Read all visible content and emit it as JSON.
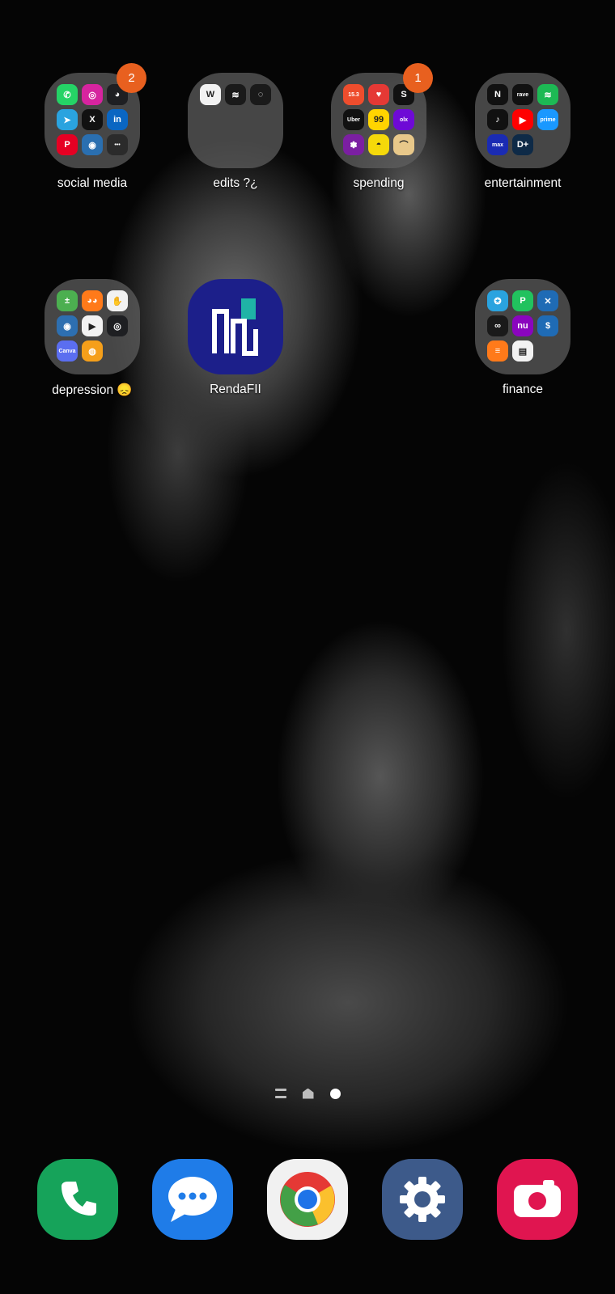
{
  "home": {
    "folders": [
      {
        "name": "social media",
        "badge": "2",
        "icons": [
          {
            "name": "whatsapp-icon",
            "color": "#25d366",
            "glyph": "✆"
          },
          {
            "name": "instagram-icon",
            "color": "#d6249f",
            "glyph": "◎"
          },
          {
            "name": "discord-icon",
            "color": "#1e1f22",
            "glyph": "◕"
          },
          {
            "name": "telegram-icon",
            "color": "#2aa3df",
            "glyph": "➤"
          },
          {
            "name": "x-icon",
            "color": "#111111",
            "glyph": "X"
          },
          {
            "name": "linkedin-icon",
            "color": "#0a66c2",
            "glyph": "in"
          },
          {
            "name": "pinterest-icon",
            "color": "#e60023",
            "glyph": "P"
          },
          {
            "name": "bot-icon",
            "color": "#2a6fb0",
            "glyph": "◉"
          },
          {
            "name": "dots-app-icon",
            "color": "#2b2b2b",
            "glyph": "•••"
          }
        ]
      },
      {
        "name": "edits ?¿",
        "badge": "",
        "icons": [
          {
            "name": "word-icon",
            "color": "#f2f2f2",
            "glyph": "W"
          },
          {
            "name": "capcut-icon",
            "color": "#1a1a1a",
            "glyph": "≋"
          },
          {
            "name": "alight-icon",
            "color": "#1a1a1a",
            "glyph": "◌"
          }
        ]
      },
      {
        "name": "spending",
        "badge": "1",
        "icons": [
          {
            "name": "shopee-icon",
            "color": "#ee4d2d",
            "glyph": "15.3"
          },
          {
            "name": "shopping-bag-icon",
            "color": "#e53935",
            "glyph": "♥"
          },
          {
            "name": "shein-icon",
            "color": "#111111",
            "glyph": "S"
          },
          {
            "name": "uber-icon",
            "color": "#111111",
            "glyph": "Uber"
          },
          {
            "name": "99-icon",
            "color": "#ffd400",
            "glyph": "99"
          },
          {
            "name": "olx-icon",
            "color": "#6e0ad6",
            "glyph": "olx"
          },
          {
            "name": "ifood-icon",
            "color": "#7b1fa2",
            "glyph": "✽"
          },
          {
            "name": "burger-icon",
            "color": "#f5d90a",
            "glyph": "◓"
          },
          {
            "name": "amazon-icon",
            "color": "#e8c88a",
            "glyph": "⌒"
          }
        ]
      },
      {
        "name": "entertainment",
        "badge": "",
        "icons": [
          {
            "name": "netflix-icon",
            "color": "#111111",
            "glyph": "N"
          },
          {
            "name": "rave-icon",
            "color": "#111111",
            "glyph": "rave"
          },
          {
            "name": "spotify-icon",
            "color": "#1db954",
            "glyph": "≋"
          },
          {
            "name": "tiktok-icon",
            "color": "#111111",
            "glyph": "♪"
          },
          {
            "name": "youtube-icon",
            "color": "#ff0000",
            "glyph": "▶"
          },
          {
            "name": "prime-video-icon",
            "color": "#1a98ff",
            "glyph": "prime"
          },
          {
            "name": "max-icon",
            "color": "#1a2bb3",
            "glyph": "max"
          },
          {
            "name": "disney-plus-icon",
            "color": "#0e2a47",
            "glyph": "D+"
          }
        ]
      },
      {
        "name": "depression 😞",
        "badge": "",
        "icons": [
          {
            "name": "calculator-icon",
            "color": "#4caf50",
            "glyph": "±"
          },
          {
            "name": "owl-icon",
            "color": "#ff7a1a",
            "glyph": "◕◕"
          },
          {
            "name": "hand-icon",
            "color": "#f2f2f2",
            "glyph": "✋"
          },
          {
            "name": "vpn-cat-icon",
            "color": "#2d6fb0",
            "glyph": "◉"
          },
          {
            "name": "play-icon",
            "color": "#f2f2f2",
            "glyph": "▶"
          },
          {
            "name": "robot-icon",
            "color": "#1e1f22",
            "glyph": "◎"
          },
          {
            "name": "canva-icon",
            "color": "#5b6ef0",
            "glyph": "Canva"
          },
          {
            "name": "snake-icon",
            "color": "#f59f1a",
            "glyph": "◍"
          }
        ]
      },
      {
        "name": "finance",
        "badge": "",
        "icons": [
          {
            "name": "mercado-pago-icon",
            "color": "#2aa3df",
            "glyph": "✪"
          },
          {
            "name": "picpay-icon",
            "color": "#21c25e",
            "glyph": "P"
          },
          {
            "name": "x-bank-icon",
            "color": "#1f6bb5",
            "glyph": "✕"
          },
          {
            "name": "c6-icon",
            "color": "#1a1a1a",
            "glyph": "∞"
          },
          {
            "name": "nubank-icon",
            "color": "#8a05be",
            "glyph": "nu"
          },
          {
            "name": "caixa-icon",
            "color": "#1f6bb5",
            "glyph": "$"
          },
          {
            "name": "wave-icon",
            "color": "#ff7a1a",
            "glyph": "≡"
          },
          {
            "name": "wallet-icon",
            "color": "#f2f2f2",
            "glyph": "▤"
          }
        ]
      }
    ],
    "app": {
      "name": "RendaFII"
    }
  },
  "pager": {
    "pages": [
      "apps",
      "home",
      "current"
    ]
  },
  "dock": {
    "apps": [
      {
        "name": "phone",
        "color": "#16a35a"
      },
      {
        "name": "messages",
        "color": "#1f7ce8"
      },
      {
        "name": "chrome",
        "color": "#f1f1f1"
      },
      {
        "name": "settings",
        "color": "#3d5a8a"
      },
      {
        "name": "camera",
        "color": "#e01550"
      }
    ]
  }
}
